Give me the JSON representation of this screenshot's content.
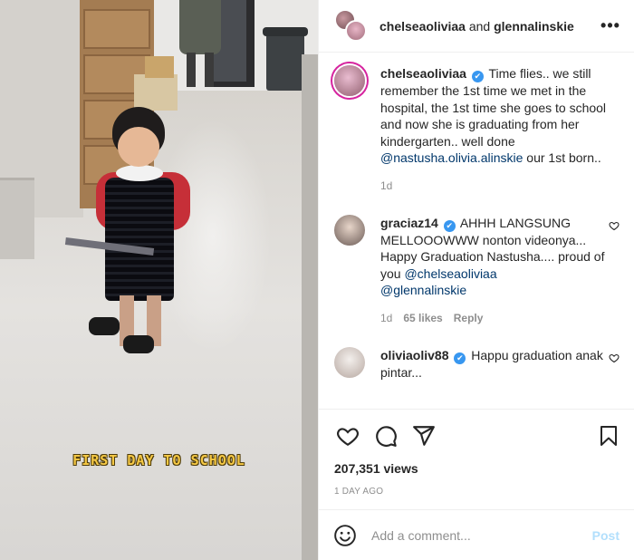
{
  "video": {
    "overlay_text": "FIRST DAY TO SCHOOL"
  },
  "header": {
    "user1": "chelseaoliviaa",
    "conjunction": "and",
    "user2": "glennalinskie",
    "more_label": "•••"
  },
  "caption": {
    "username": "chelseaoliviaa",
    "text": "Time flies.. we still remember the 1st time we met in the hospital, the 1st time she goes to school and now she is graduating from her kindergarten.. well done",
    "mention": "@nastusha.olivia.alinskie",
    "text_after": "our 1st born..",
    "time": "1d"
  },
  "comments": [
    {
      "username": "graciaz14",
      "verified": "✔",
      "text": "AHHH LANGSUNG MELLOOOWWW nonton videonya... Happy Graduation Nastusha.... proud of you",
      "mention1": "@chelseaoliviaa",
      "mention2": "@glennalinskie",
      "time": "1d",
      "likes": "65 likes",
      "reply": "Reply"
    },
    {
      "username": "oliviaoliv88",
      "verified": "✔",
      "text": "Happu graduation anak pintar..."
    }
  ],
  "actions": {
    "icons": [
      "heart-icon",
      "comment-icon",
      "share-icon",
      "bookmark-icon"
    ]
  },
  "stats": {
    "views": "207,351 views",
    "posted": "1 DAY AGO"
  },
  "composer": {
    "placeholder": "Add a comment...",
    "post_label": "Post"
  },
  "colors": {
    "caption_text": "#f6c945",
    "mention": "#00376b",
    "verified": "#3897f0",
    "post_disabled": "#b2dffc"
  }
}
